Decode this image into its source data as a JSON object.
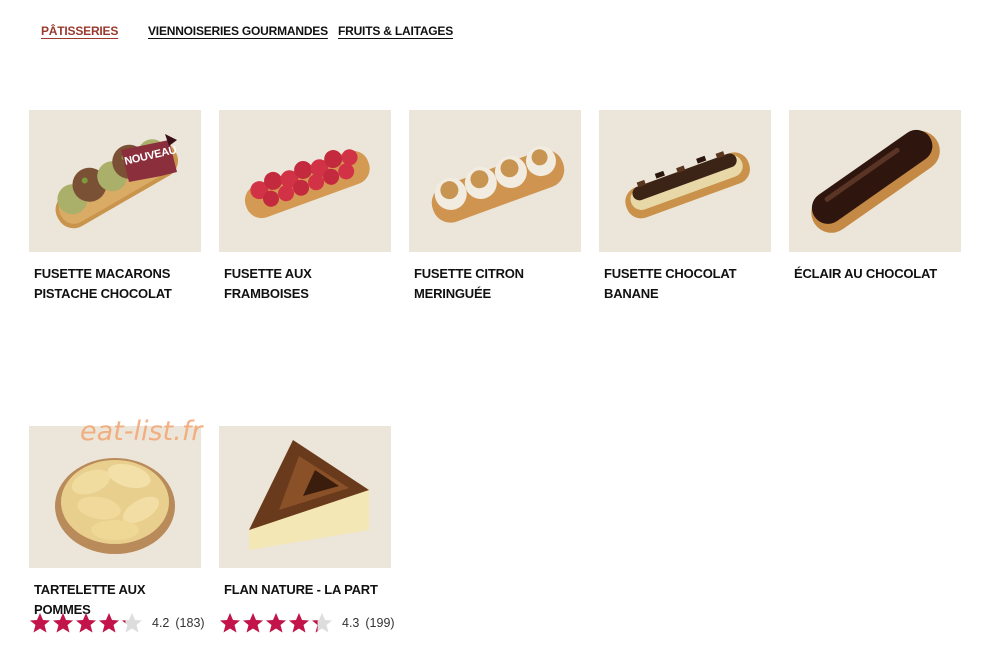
{
  "tabs": [
    {
      "label": "PÂTISSERIES",
      "active": true
    },
    {
      "label": "VIENNOISERIES GOURMANDES",
      "active": false
    },
    {
      "label": "FRUITS & LAITAGES",
      "active": false
    }
  ],
  "products": [
    {
      "name": "FUSETTE MACARONS PISTACHE CHOCOLAT",
      "badge": "NOUVEAU",
      "image": "macaron-fusette-image"
    },
    {
      "name": "FUSETTE AUX FRAMBOISES",
      "image": "raspberry-fusette-image"
    },
    {
      "name": "FUSETTE CITRON MERINGUÉE",
      "image": "lemon-meringue-fusette-image"
    },
    {
      "name": "FUSETTE CHOCOLAT BANANE",
      "image": "chocolate-banana-fusette-image"
    },
    {
      "name": "ÉCLAIR AU CHOCOLAT",
      "image": "chocolate-eclair-image"
    },
    {
      "name": "TARTELETTE AUX POMMES",
      "image": "apple-tart-image",
      "rating": 4.2,
      "rating_text": "4.2",
      "reviews": "(183)"
    },
    {
      "name": "FLAN NATURE - LA PART",
      "image": "flan-slice-image",
      "rating": 4.3,
      "rating_text": "4.3",
      "reviews": "(199)"
    }
  ],
  "watermark": "eat-list.fr",
  "colors": {
    "active_tab": "#9a3a2e",
    "star": "#c2134a",
    "star_empty": "#dddddd",
    "thumb_bg": "#ece6da",
    "badge": "#8b2f3c"
  }
}
